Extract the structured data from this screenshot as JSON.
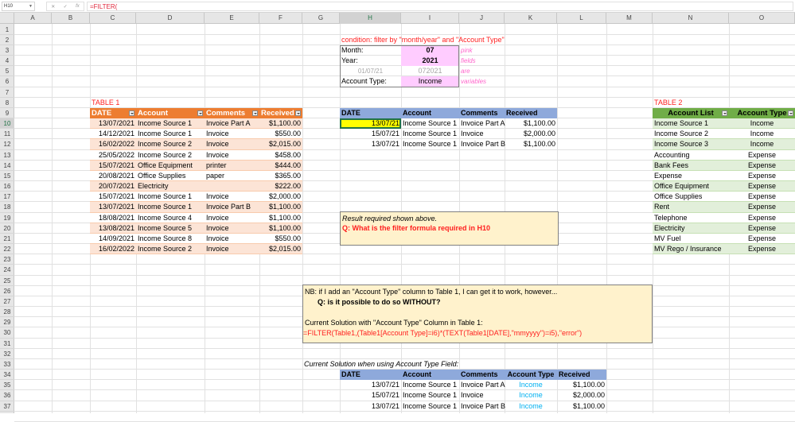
{
  "formula_bar": {
    "name_box": "H10",
    "cancel_icon": "✕",
    "enter_icon": "✓",
    "fx_label": "fx",
    "formula": "=FILTER("
  },
  "columns": [
    "A",
    "B",
    "C",
    "D",
    "E",
    "F",
    "G",
    "H",
    "I",
    "J",
    "K",
    "L",
    "M",
    "N",
    "O"
  ],
  "rows": [
    "1",
    "2",
    "3",
    "4",
    "5",
    "6",
    "7",
    "8",
    "9",
    "10",
    "11",
    "12",
    "13",
    "14",
    "15",
    "16",
    "17",
    "18",
    "19",
    "20",
    "21",
    "22",
    "23",
    "24",
    "25",
    "26",
    "27",
    "28",
    "29",
    "30",
    "31",
    "32",
    "33",
    "34",
    "35",
    "36",
    "37"
  ],
  "selected_cell": "H10",
  "table1": {
    "title": "TABLE 1",
    "headers": [
      "DATE",
      "Account",
      "Comments",
      "Received"
    ],
    "rows": [
      [
        "13/07/2021",
        "Income Source 1",
        "Invoice Part A",
        "$1,100.00"
      ],
      [
        "14/12/2021",
        "Income Source 1",
        "Invoice",
        "$550.00"
      ],
      [
        "16/02/2022",
        "Income Source 2",
        "Invoice",
        "$2,015.00"
      ],
      [
        "25/05/2022",
        "Income Source 2",
        "Invoice",
        "$458.00"
      ],
      [
        "15/07/2021",
        "Office Equipment",
        "printer",
        "$444.00"
      ],
      [
        "20/08/2021",
        "Office Supplies",
        "paper",
        "$365.00"
      ],
      [
        "20/07/2021",
        "Electricity",
        "",
        "$222.00"
      ],
      [
        "15/07/2021",
        "Income Source 1",
        "Invoice",
        "$2,000.00"
      ],
      [
        "13/07/2021",
        "Income Source 1",
        "Invoice Part B",
        "$1,100.00"
      ],
      [
        "18/08/2021",
        "Income Source 4",
        "Invoice",
        "$1,100.00"
      ],
      [
        "13/08/2021",
        "Income Source 5",
        "Invoice",
        "$1,100.00"
      ],
      [
        "14/09/2021",
        "Income Source 8",
        "Invoice",
        "$550.00"
      ],
      [
        "16/02/2022",
        "Income Source 2",
        "Invoice",
        "$2,015.00"
      ]
    ]
  },
  "condition": {
    "title": "condition: filter by \"month/year\" and \"Account Type\"",
    "month_label": "Month:",
    "month_value": "07",
    "note1": "pink",
    "year_label": "Year:",
    "year_value": "2021",
    "note2": "fields",
    "date_helper": "01/07/21",
    "mmyyyy_helper": "072021",
    "note3": "are",
    "type_label": "Account Type:",
    "type_value": "Income",
    "note4": "variables"
  },
  "result": {
    "headers": [
      "DATE",
      "Account",
      "Comments",
      "Received"
    ],
    "rows": [
      [
        "13/07/21",
        "Income Source 1",
        "Invoice Part A",
        "$1,100.00"
      ],
      [
        "15/07/21",
        "Income Source 1",
        "Invoice",
        "$2,000.00"
      ],
      [
        "13/07/21",
        "Income Source 1",
        "Invoice Part B",
        "$1,100.00"
      ]
    ]
  },
  "note_box": {
    "line1": "Result required shown above.",
    "line2": "Q: What is the filter formula required in H10"
  },
  "nb_box": {
    "line1": "NB: if I add an \"Account Type\" column to Table 1, I can get it to work, however...",
    "line2": "Q: is it possible to do so WITHOUT?",
    "line3": "Current Solution with \"Account Type\" Column in Table 1:",
    "line4": "=FILTER(Table1,(Table1[Account Type]=i6)*(TEXT(Table1[DATE],\"mmyyyy\")=i5),\"error\")"
  },
  "current_solution": {
    "title": "Current Solution when using Account Type Field:",
    "headers": [
      "DATE",
      "Account",
      "Comments",
      "Account Type",
      "Received"
    ],
    "rows": [
      [
        "13/07/21",
        "Income Source 1",
        "Invoice Part A",
        "Income",
        "$1,100.00"
      ],
      [
        "15/07/21",
        "Income Source 1",
        "Invoice",
        "Income",
        "$2,000.00"
      ],
      [
        "13/07/21",
        "Income Source 1",
        "Invoice Part B",
        "Income",
        "$1,100.00"
      ]
    ]
  },
  "table2": {
    "title": "TABLE 2",
    "headers": [
      "Account List",
      "Account Type"
    ],
    "rows": [
      [
        "Income Source 1",
        "Income"
      ],
      [
        "Income Source 2",
        "Income"
      ],
      [
        "Income Source 3",
        "Income"
      ],
      [
        "Accounting",
        "Expense"
      ],
      [
        "Bank Fees",
        "Expense"
      ],
      [
        "Expense",
        "Expense"
      ],
      [
        "Office Equipment",
        "Expense"
      ],
      [
        "Office Supplies",
        "Expense"
      ],
      [
        "Rent",
        "Expense"
      ],
      [
        "Telephone",
        "Expense"
      ],
      [
        "Electricity",
        "Expense"
      ],
      [
        "MV Fuel",
        "Expense"
      ],
      [
        "MV Rego / Insurance",
        "Expense"
      ]
    ]
  },
  "colors": {
    "table1_header": "#ed7d31",
    "table1_band": "#fce4d6",
    "table2_header": "#70ad47",
    "table2_band": "#e2efda",
    "blue_header": "#8ea9db",
    "pink": "#ffccff",
    "yellow": "#ffff00",
    "note_bg": "#fff2cc",
    "accent_red": "#ff1f1f",
    "income_blue": "#00b0f0"
  }
}
